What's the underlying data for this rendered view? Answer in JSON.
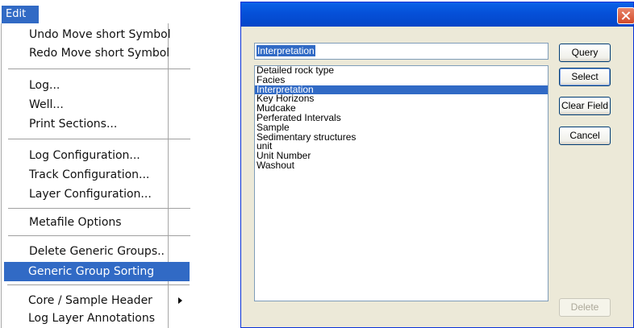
{
  "menu": {
    "header": "Edit",
    "items": [
      {
        "label": "Undo Move short Symbol"
      },
      {
        "label": "Redo Move short Symbol"
      },
      {
        "label": "Log..."
      },
      {
        "label": "Well..."
      },
      {
        "label": "Print Sections..."
      },
      {
        "label": "Log Configuration..."
      },
      {
        "label": "Track Configuration..."
      },
      {
        "label": "Layer Configuration..."
      },
      {
        "label": "Metafile Options"
      },
      {
        "label": "Delete Generic Groups.."
      },
      {
        "label": "Generic Group Sorting"
      },
      {
        "label": "Core / Sample Header"
      },
      {
        "label": "Log Layer Annotations"
      }
    ]
  },
  "dialog": {
    "field_value": "Interpretation",
    "list": [
      "Detailed rock type",
      "Facies",
      "Interpretation",
      "Key Horizons",
      "Mudcake",
      "Perferated Intervals",
      "Sample",
      "Sedimentary structures",
      "unit",
      "Unit Number",
      "Washout"
    ],
    "buttons": {
      "query": "Query",
      "select": "Select",
      "clear_field": "Clear Field",
      "cancel": "Cancel",
      "delete": "Delete"
    }
  }
}
